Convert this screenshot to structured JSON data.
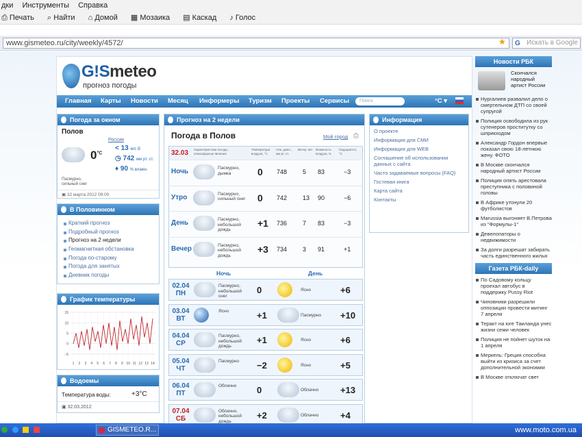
{
  "browser": {
    "menu": [
      "дки",
      "Инструменты",
      "Справка"
    ],
    "favorites": [
      {
        "icon": "print-icon",
        "label": "Печать"
      },
      {
        "icon": "find-icon",
        "label": "Найти"
      },
      {
        "icon": "home-icon",
        "label": "Домой"
      },
      {
        "icon": "mosaic-icon",
        "label": "Мозаика"
      },
      {
        "icon": "cascade-icon",
        "label": "Каскад"
      },
      {
        "icon": "voice-icon",
        "label": "Голос"
      }
    ],
    "url": "www.gismeteo.ru/city/weekly/4572/",
    "search_placeholder": "Искать в Google"
  },
  "site": {
    "logo_name_a": "G!S",
    "logo_name_b": "meteo",
    "logo_sub": "прогноз погоды",
    "nav": [
      "Главная",
      "Карты",
      "Новости",
      "Месяц",
      "Информеры",
      "Туризм",
      "Проекты",
      "Сервисы"
    ],
    "nav_search": "Поиск",
    "unit_btn": "°C ▾"
  },
  "now": {
    "title": "Погода за окном",
    "city": "Полов",
    "region": "Россия",
    "temp": "0",
    "temp_unit": "°C",
    "wind": "13",
    "wind_unit": "м/с В",
    "pressure": "742",
    "pressure_unit": "мм рт. ст.",
    "humidity": "90",
    "humidity_unit": "% влажн.",
    "cond": "Пасмурно, сильный снег",
    "updated": "32 марта 2012 09:00"
  },
  "inplace": {
    "title": "В Половинном",
    "items": [
      "Краткий прогноз",
      "Подробный прогноз",
      "Прогноз на 2 недели",
      "Геомагнитная обстановка",
      "Погода по-старому",
      "Погода для занятых",
      "Дневник погоды"
    ],
    "active": "Прогноз на 2 недели"
  },
  "temp_chart": {
    "title": "График температуры"
  },
  "water": {
    "title": "Водоемы",
    "label": "Температура воды:",
    "value": "+3°C",
    "date": "32.03.2012"
  },
  "forecast": {
    "title": "Прогноз на 2 недели",
    "heading": "Погода в Полов",
    "my_city": "Мой город",
    "today_date": "32.03",
    "columns": [
      "Характеристики погоды, атмосферные явления",
      "Температура воздуха, °C",
      "Атм. давл., мм рт. ст.",
      "Ветер, м/с",
      "Влажность воздуха, %",
      "Ощущается, °C"
    ],
    "periods": [
      {
        "label": "Ночь",
        "cond": "Пасмурно, дымка",
        "t": "0",
        "p": "748",
        "w": "5",
        "h": "83",
        "f": "−3"
      },
      {
        "label": "Утро",
        "cond": "Пасмурно, сильный снег",
        "t": "0",
        "p": "742",
        "w": "13",
        "h": "90",
        "f": "−6"
      },
      {
        "label": "День",
        "cond": "Пасмурно, небольшой дождь",
        "t": "+1",
        "p": "736",
        "w": "7",
        "h": "83",
        "f": "−3"
      },
      {
        "label": "Вечер",
        "cond": "Пасмурно, небольшой дождь",
        "t": "+3",
        "p": "734",
        "w": "3",
        "h": "91",
        "f": "+1"
      }
    ],
    "night_label": "Ночь",
    "day_label": "День",
    "days": [
      {
        "date": "02.04",
        "dow": "ПН",
        "ncond": "Пасмурно, небольшой снег",
        "nt": "0",
        "dcond": "Ясно",
        "dt": "+6"
      },
      {
        "date": "03.04",
        "dow": "ВТ",
        "ncond": "Ясно",
        "nt": "+1",
        "dcond": "Пасмурно",
        "dt": "+10"
      },
      {
        "date": "04.04",
        "dow": "СР",
        "ncond": "Пасмурно, небольшой дождь",
        "nt": "+1",
        "dcond": "Ясно",
        "dt": "+6"
      },
      {
        "date": "05.04",
        "dow": "ЧТ",
        "ncond": "Пасмурно",
        "nt": "−2",
        "dcond": "Ясно",
        "dt": "+5"
      },
      {
        "date": "06.04",
        "dow": "ПТ",
        "ncond": "Облачно",
        "nt": "0",
        "dcond": "Облачно",
        "dt": "+13"
      },
      {
        "date": "07.04",
        "dow": "СБ",
        "ncond": "Облачно, небольшой дождь",
        "nt": "+2",
        "dcond": "Облачно",
        "dt": "+4"
      }
    ]
  },
  "info": {
    "title": "Информация",
    "items": [
      "О проекте",
      "Информация для СМИ",
      "Информация для WEB",
      "Соглашение об использовании данных с сайта",
      "Часто задаваемые вопросы (FAQ)",
      "Гостевая книга",
      "Карта сайта",
      "Контакты"
    ]
  },
  "news_rbk": {
    "title": "Новости РБК",
    "lead": "Скончался народный артист России",
    "items": [
      "Нургалиев развалил дело о смертельном ДТП со своей супругой",
      "Полиция освободила из рук сутенеров проститутку со шприкходом",
      "Александр Гордон впервые показал свою 18-летнюю жену. ФОТО",
      "В Москве скончался народный артист России",
      "Полиция опять арестовала преступника с половиной головы",
      "В Африке утонули 20 футболистов",
      "Marussia выгоняет В.Петрова из \"Формулы-1\"",
      "Девелопаторы о недвижимости",
      "За долги разрешат забирать часть единственного жилья"
    ]
  },
  "rbk_daily": {
    "title": "Газета РБК-daily",
    "items": [
      "По Садовому кольцу проехал автобус в поддержку Pussy Riot",
      "Чиновники разрешили оппозиции провести митинг 7 апреля",
      "Теракт на юге Таиланда унес жизни семи человек",
      "Полиция не пойнет шуток на 1 апреля",
      "Меркель: Греция способна выйти из кризиса за счет дополнительной экономии",
      "В Москве отключат свет"
    ]
  },
  "taskbar": {
    "window": "GISMETEO.R...",
    "watermark": "www.moto.com.ua"
  },
  "chart_data": {
    "type": "line",
    "title": "График температуры",
    "xlabel": "",
    "ylabel": "",
    "x_ticks": [
      "1",
      "2",
      "3",
      "4",
      "5",
      "6",
      "7",
      "8",
      "9",
      "10",
      "11",
      "12",
      "13",
      "14"
    ],
    "y_ticks": [
      "−5",
      "0",
      "5",
      "10",
      "15"
    ],
    "ylim": [
      -7,
      16
    ],
    "grid": true,
    "series": [
      {
        "values": [
          0,
          5,
          -2,
          6,
          -1,
          7,
          -3,
          8,
          1,
          6,
          -2,
          9,
          0,
          10,
          -1,
          8,
          -3,
          11,
          1,
          7,
          0,
          12,
          2,
          9,
          -1,
          13,
          3,
          10,
          0,
          12
        ],
        "color": "#c0282d"
      }
    ]
  },
  "colors": {
    "accent": "#2d74b6",
    "link": "#4a6fa0",
    "today": "#c62020"
  }
}
